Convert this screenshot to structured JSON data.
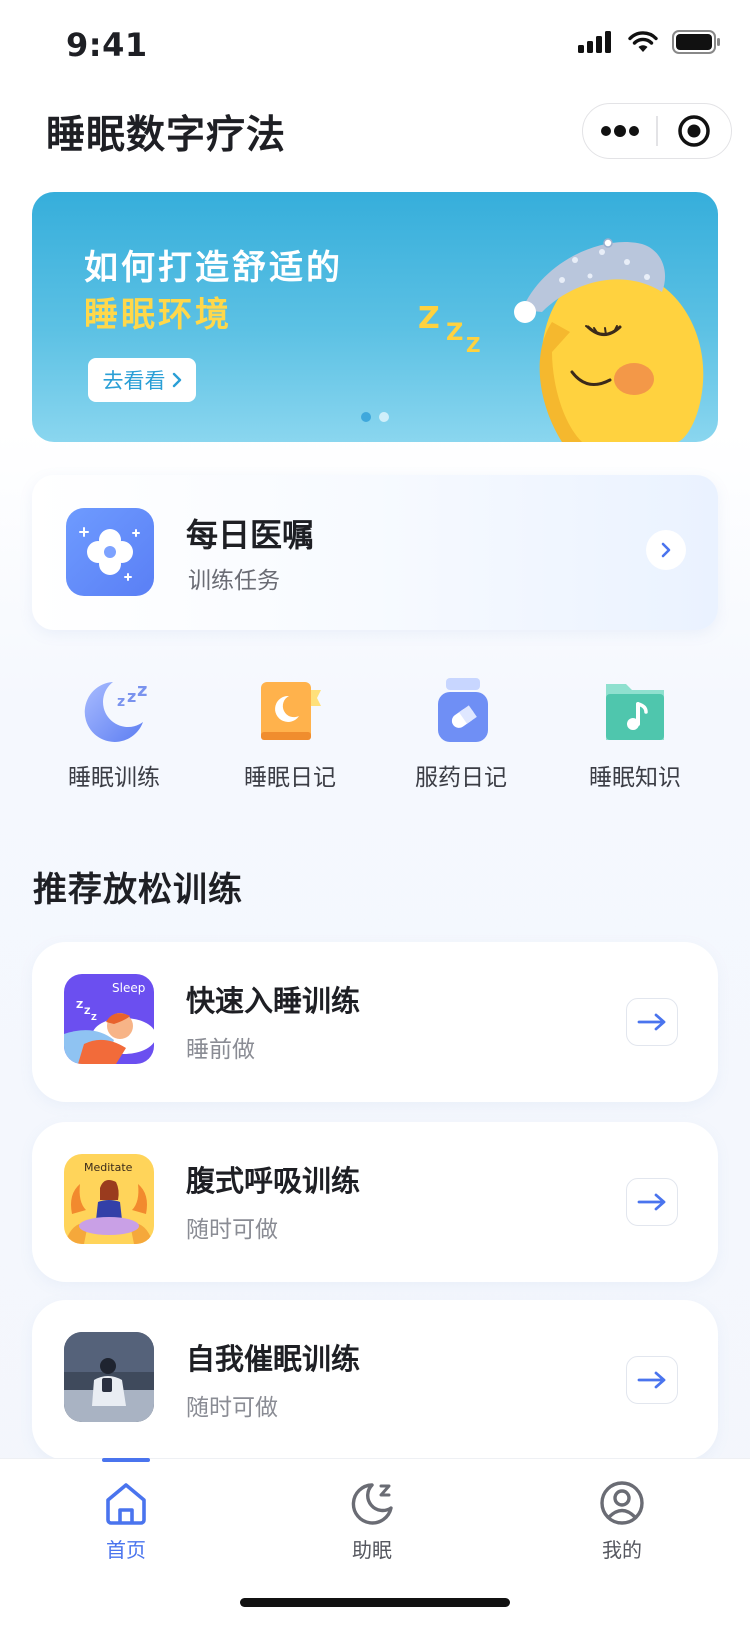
{
  "status_bar": {
    "time": "9:41"
  },
  "nav": {
    "title": "睡眠数字疗法"
  },
  "banner": {
    "line1": "如何打造舒适的",
    "line2": "睡眠环境",
    "button_label": "去看看",
    "zzz": "Z Z Z"
  },
  "daily_order": {
    "title": "每日医嘱",
    "subtitle": "训练任务"
  },
  "quick_actions": [
    {
      "label": "睡眠训练",
      "icon": "moon-zzz-icon"
    },
    {
      "label": "睡眠日记",
      "icon": "diary-book-icon"
    },
    {
      "label": "服药日记",
      "icon": "pill-bottle-icon"
    },
    {
      "label": "睡眠知识",
      "icon": "music-folder-icon"
    }
  ],
  "section": {
    "title": "推荐放松训练"
  },
  "trainings": [
    {
      "title": "快速入睡训练",
      "subtitle": "睡前做",
      "thumb_label": "Sleep"
    },
    {
      "title": "腹式呼吸训练",
      "subtitle": "随时可做",
      "thumb_label": "Meditate"
    },
    {
      "title": "自我催眠训练",
      "subtitle": "随时可做"
    }
  ],
  "tabs": [
    {
      "label": "首页",
      "icon": "home-icon",
      "active": true
    },
    {
      "label": "助眠",
      "icon": "moon-icon",
      "active": false
    },
    {
      "label": "我的",
      "icon": "user-icon",
      "active": false
    }
  ],
  "colors": {
    "accent": "#4a74ee",
    "banner": "#36aedb",
    "highlight": "#ffd84a"
  }
}
